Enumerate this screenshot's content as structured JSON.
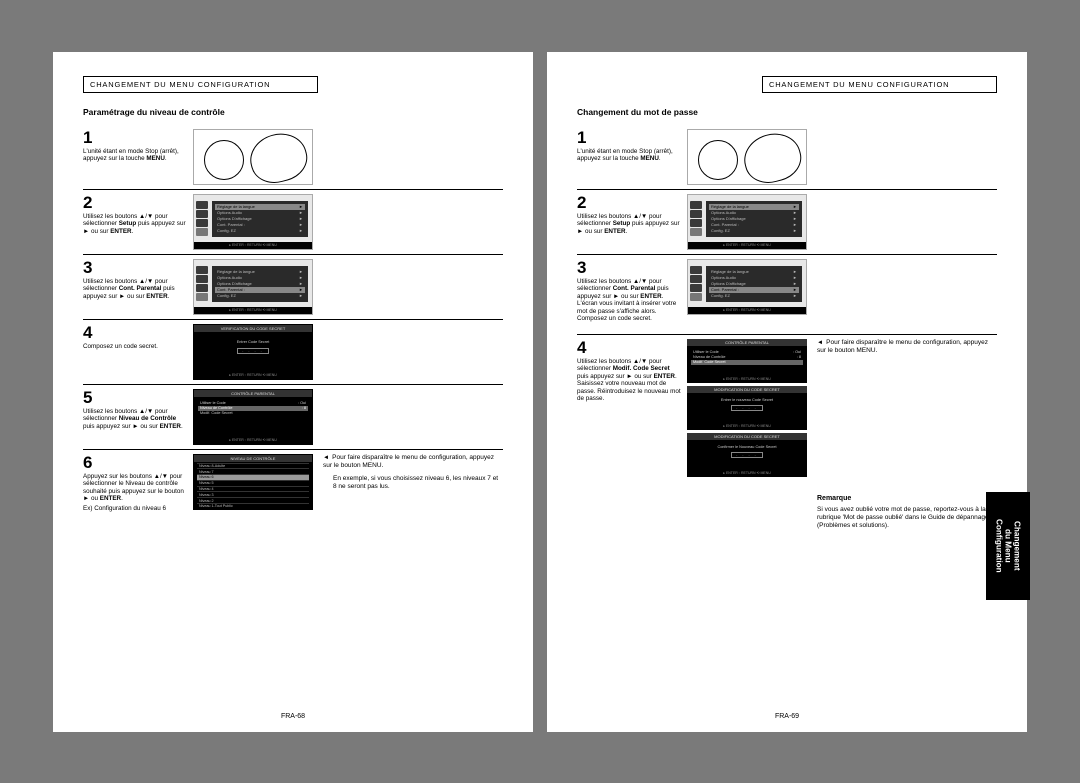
{
  "left": {
    "header": "CHANGEMENT DU MENU CONFIGURATION",
    "title": "Paramétrage du niveau de contrôle",
    "steps": {
      "s1": {
        "num": "1",
        "text": "L'unité étant en mode Stop (arrêt), appuyez sur la touche ",
        "bold": "MENU",
        "after": "."
      },
      "s2": {
        "num": "2",
        "text": "Utilisez les boutons ▲/▼ pour sélectionner ",
        "bold": "Setup",
        "after": " puis appuyez sur ► ou sur ",
        "bold2": "ENTER",
        "after2": "."
      },
      "s3": {
        "num": "3",
        "text": "Utilisez les boutons ▲/▼ pour sélectionner ",
        "bold": "Cont. Parental",
        "after": " puis appuyez sur ► ou sur ",
        "bold2": "ENTER",
        "after2": "."
      },
      "s4": {
        "num": "4",
        "text": "Composez un code secret."
      },
      "s5": {
        "num": "5",
        "text": "Utilisez les boutons ▲/▼ pour sélectionner ",
        "bold": "Niveau de Contrôle",
        "after": " puis appuyez sur ► ou sur ",
        "bold2": "ENTER",
        "after2": "."
      },
      "s6": {
        "num": "6",
        "text": "Appuyez sur les boutons ▲/▼ pour sélectionner le Niveau de contrôle souhaité puis appuyez sur le bouton ► ou ",
        "bold": "ENTER",
        "after": ".",
        "ex": "Ex) Configuration du niveau 6"
      }
    },
    "note1": "Pour faire disparaître le menu de configuration, appuyez sur le bouton MENU.",
    "note2": "En exemple, si vous choisissez niveau 6, les niveaux 7 et 8 ne seront pas lus.",
    "menu_items": {
      "m1": "Réglage de la langue",
      "m2": "Options Audio",
      "m3": "Options D'affichage",
      "m4": "Cont. Parental :",
      "m5": "Config. EZ"
    },
    "footer_bar": "▸ ENTER  ▫ RETURN  ⟲ MENU",
    "code_title": "VERIFICATION DU CODE SECRET",
    "code_label": "Entrer Code Secret",
    "ctrl_title": "CONTRÔLE PARENTAL",
    "ctrl_r1": "Utiliser le Code",
    "ctrl_r1v": ": Oui",
    "ctrl_r2": "Niveau de Contrôle",
    "ctrl_r2v": ": 8",
    "ctrl_r3": "Modif. Code Secret",
    "level_title": "NIVEAU DE CONTRÔLE",
    "levels": [
      "Niveau 8-Adulte",
      "Niveau 7",
      "Niveau 6",
      "Niveau 5",
      "Niveau 4",
      "Niveau 3",
      "Niveau 2",
      "Niveau 1-Tout Public"
    ],
    "pageno": "FRA-68"
  },
  "right": {
    "header": "CHANGEMENT DU MENU CONFIGURATION",
    "title": "Changement du mot de passe",
    "steps": {
      "s1": {
        "num": "1",
        "text": "L'unité étant en mode Stop (arrêt), appuyez sur la touche ",
        "bold": "MENU",
        "after": "."
      },
      "s2": {
        "num": "2",
        "text": "Utilisez les boutons ▲/▼ pour sélectionner ",
        "bold": "Setup",
        "after": " puis appuyez sur ► ou sur ",
        "bold2": "ENTER",
        "after2": "."
      },
      "s3": {
        "num": "3",
        "text": "Utilisez les boutons ▲/▼ pour sélectionner ",
        "bold": "Cont. Parental",
        "after": " puis appuyez sur ► ou sur ",
        "bold2": "ENTER",
        "after2": ". L'écran vous invitant à insérer votre mot de passe s'affiche alors. Composez un code secret."
      },
      "s4": {
        "num": "4",
        "text": "Utilisez les boutons ▲/▼ pour sélectionner ",
        "bold": "Modif. Code Secret",
        "after": " puis appuyez sur ► ou sur ",
        "bold2": "ENTER",
        "after2": ". Saisissez votre nouveau mot de passe. Réintroduisez le nouveau mot de passe."
      }
    },
    "note1": "Pour faire disparaître le menu de configuration, appuyez sur le bouton MENU.",
    "menu_items": {
      "m1": "Réglage de la langue",
      "m2": "Options Audio",
      "m3": "Options D'affichage",
      "m4": "Cont. Parental :",
      "m5": "Config. EZ"
    },
    "footer_bar": "▸ ENTER  ▫ RETURN  ⟲ MENU",
    "ctrl_title": "CONTRÔLE PARENTAL",
    "ctrl_r1": "Utiliser le Code",
    "ctrl_r1v": ": Oui",
    "ctrl_r2": "Niveau de Contrôle",
    "ctrl_r2v": ": 8",
    "ctrl_r3": "Modif. Code Secret",
    "mod_title": "MODIFICATION DU CODE SECRET",
    "mod_line1": "Entrer le nouveau Code Secret",
    "mod_line2": "Confirmer le Nouveau Code Secret",
    "remark_title": "Remarque",
    "remark_text": "Si vous avez oublié votre mot de passe, reportez-vous à la rubrique 'Mot de passe oublié' dans le Guide de dépannage (Problèmes et solutions).",
    "sidetab": "Changement\ndu Menu\nConfiguration",
    "pageno": "FRA-69"
  }
}
